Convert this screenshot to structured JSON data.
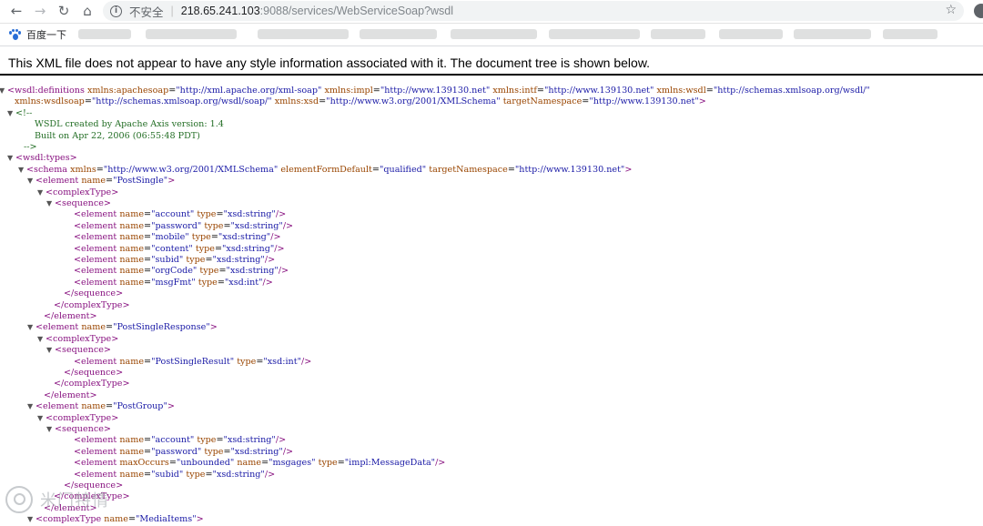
{
  "browser": {
    "url_insecure_label": "不安全",
    "url_host": "218.65.241.103",
    "url_path": ":9088/services/WebServiceSoap?wsdl",
    "bookmark_first": "百度一下"
  },
  "page": {
    "notice": "This XML file does not appear to have any style information associated with it. The document tree is shown below."
  },
  "xml_lines": [
    {
      "indent": 8,
      "tw": "▼",
      "parts": [
        [
          "tag",
          "<wsdl:definitions "
        ],
        [
          "attr",
          "xmlns:apachesoap"
        ],
        [
          "plain",
          "="
        ],
        [
          "val",
          "\"http://xml.apache.org/xml-soap\""
        ],
        [
          "attr",
          " xmlns:impl"
        ],
        [
          "plain",
          "="
        ],
        [
          "val",
          "\"http://www.139130.net\""
        ],
        [
          "attr",
          " xmlns:intf"
        ],
        [
          "plain",
          "="
        ],
        [
          "val",
          "\"http://www.139130.net\""
        ],
        [
          "attr",
          " xmlns:wsdl"
        ],
        [
          "plain",
          "="
        ],
        [
          "val",
          "\"http://schemas.xmlsoap.org/wsdl/\""
        ]
      ]
    },
    {
      "indent": 16,
      "tw": "",
      "parts": [
        [
          "attr",
          "xmlns:wsdlsoap"
        ],
        [
          "plain",
          "="
        ],
        [
          "val",
          "\"http://schemas.xmlsoap.org/wsdl/soap/\""
        ],
        [
          "attr",
          " xmlns:xsd"
        ],
        [
          "plain",
          "="
        ],
        [
          "val",
          "\"http://www.w3.org/2001/XMLSchema\""
        ],
        [
          "attr",
          " targetNamespace"
        ],
        [
          "plain",
          "="
        ],
        [
          "val",
          "\"http://www.139130.net\""
        ],
        [
          "tag",
          ">"
        ]
      ]
    },
    {
      "indent": 17,
      "tw": "▼",
      "parts": [
        [
          "comment",
          "<!--"
        ]
      ]
    },
    {
      "indent": 38,
      "tw": "",
      "parts": [
        [
          "comment",
          "WSDL created by Apache Axis version: 1.4"
        ]
      ]
    },
    {
      "indent": 38,
      "tw": "",
      "parts": [
        [
          "comment",
          "Built on Apr 22, 2006 (06:55:48 PDT)"
        ]
      ]
    },
    {
      "indent": 26,
      "tw": "",
      "parts": [
        [
          "comment",
          "-->"
        ]
      ]
    },
    {
      "indent": 17,
      "tw": "▼",
      "parts": [
        [
          "tag",
          "<wsdl:types>"
        ]
      ]
    },
    {
      "indent": 29,
      "tw": "▼",
      "parts": [
        [
          "tag",
          "<schema "
        ],
        [
          "attr",
          "xmlns"
        ],
        [
          "plain",
          "="
        ],
        [
          "val",
          "\"http://www.w3.org/2001/XMLSchema\""
        ],
        [
          "attr",
          " elementFormDefault"
        ],
        [
          "plain",
          "="
        ],
        [
          "val",
          "\"qualified\""
        ],
        [
          "attr",
          " targetNamespace"
        ],
        [
          "plain",
          "="
        ],
        [
          "val",
          "\"http://www.139130.net\""
        ],
        [
          "tag",
          ">"
        ]
      ]
    },
    {
      "indent": 39,
      "tw": "▼",
      "parts": [
        [
          "tag",
          "<element "
        ],
        [
          "attr",
          "name"
        ],
        [
          "plain",
          "="
        ],
        [
          "val",
          "\"PostSingle\""
        ],
        [
          "tag",
          ">"
        ]
      ]
    },
    {
      "indent": 50,
      "tw": "▼",
      "parts": [
        [
          "tag",
          "<complexType>"
        ]
      ]
    },
    {
      "indent": 60,
      "tw": "▼",
      "parts": [
        [
          "tag",
          "<sequence>"
        ]
      ]
    },
    {
      "indent": 81,
      "tw": "",
      "parts": [
        [
          "tag",
          "<element "
        ],
        [
          "attr",
          "name"
        ],
        [
          "plain",
          "="
        ],
        [
          "val",
          "\"account\""
        ],
        [
          "attr",
          " type"
        ],
        [
          "plain",
          "="
        ],
        [
          "val",
          "\"xsd:string\""
        ],
        [
          "tag",
          "/>"
        ]
      ]
    },
    {
      "indent": 81,
      "tw": "",
      "parts": [
        [
          "tag",
          "<element "
        ],
        [
          "attr",
          "name"
        ],
        [
          "plain",
          "="
        ],
        [
          "val",
          "\"password\""
        ],
        [
          "attr",
          " type"
        ],
        [
          "plain",
          "="
        ],
        [
          "val",
          "\"xsd:string\""
        ],
        [
          "tag",
          "/>"
        ]
      ]
    },
    {
      "indent": 81,
      "tw": "",
      "parts": [
        [
          "tag",
          "<element "
        ],
        [
          "attr",
          "name"
        ],
        [
          "plain",
          "="
        ],
        [
          "val",
          "\"mobile\""
        ],
        [
          "attr",
          " type"
        ],
        [
          "plain",
          "="
        ],
        [
          "val",
          "\"xsd:string\""
        ],
        [
          "tag",
          "/>"
        ]
      ]
    },
    {
      "indent": 81,
      "tw": "",
      "parts": [
        [
          "tag",
          "<element "
        ],
        [
          "attr",
          "name"
        ],
        [
          "plain",
          "="
        ],
        [
          "val",
          "\"content\""
        ],
        [
          "attr",
          " type"
        ],
        [
          "plain",
          "="
        ],
        [
          "val",
          "\"xsd:string\""
        ],
        [
          "tag",
          "/>"
        ]
      ]
    },
    {
      "indent": 81,
      "tw": "",
      "parts": [
        [
          "tag",
          "<element "
        ],
        [
          "attr",
          "name"
        ],
        [
          "plain",
          "="
        ],
        [
          "val",
          "\"subid\""
        ],
        [
          "attr",
          " type"
        ],
        [
          "plain",
          "="
        ],
        [
          "val",
          "\"xsd:string\""
        ],
        [
          "tag",
          "/>"
        ]
      ]
    },
    {
      "indent": 81,
      "tw": "",
      "parts": [
        [
          "tag",
          "<element "
        ],
        [
          "attr",
          "name"
        ],
        [
          "plain",
          "="
        ],
        [
          "val",
          "\"orgCode\""
        ],
        [
          "attr",
          " type"
        ],
        [
          "plain",
          "="
        ],
        [
          "val",
          "\"xsd:string\""
        ],
        [
          "tag",
          "/>"
        ]
      ]
    },
    {
      "indent": 81,
      "tw": "",
      "parts": [
        [
          "tag",
          "<element "
        ],
        [
          "attr",
          "name"
        ],
        [
          "plain",
          "="
        ],
        [
          "val",
          "\"msgFmt\""
        ],
        [
          "attr",
          " type"
        ],
        [
          "plain",
          "="
        ],
        [
          "val",
          "\"xsd:int\""
        ],
        [
          "tag",
          "/>"
        ]
      ]
    },
    {
      "indent": 70,
      "tw": "",
      "parts": [
        [
          "tag",
          "</sequence>"
        ]
      ]
    },
    {
      "indent": 59,
      "tw": "",
      "parts": [
        [
          "tag",
          "</complexType>"
        ]
      ]
    },
    {
      "indent": 48,
      "tw": "",
      "parts": [
        [
          "tag",
          "</element>"
        ]
      ]
    },
    {
      "indent": 39,
      "tw": "▼",
      "parts": [
        [
          "tag",
          "<element "
        ],
        [
          "attr",
          "name"
        ],
        [
          "plain",
          "="
        ],
        [
          "val",
          "\"PostSingleResponse\""
        ],
        [
          "tag",
          ">"
        ]
      ]
    },
    {
      "indent": 50,
      "tw": "▼",
      "parts": [
        [
          "tag",
          "<complexType>"
        ]
      ]
    },
    {
      "indent": 60,
      "tw": "▼",
      "parts": [
        [
          "tag",
          "<sequence>"
        ]
      ]
    },
    {
      "indent": 81,
      "tw": "",
      "parts": [
        [
          "tag",
          "<element "
        ],
        [
          "attr",
          "name"
        ],
        [
          "plain",
          "="
        ],
        [
          "val",
          "\"PostSingleResult\""
        ],
        [
          "attr",
          " type"
        ],
        [
          "plain",
          "="
        ],
        [
          "val",
          "\"xsd:int\""
        ],
        [
          "tag",
          "/>"
        ]
      ]
    },
    {
      "indent": 70,
      "tw": "",
      "parts": [
        [
          "tag",
          "</sequence>"
        ]
      ]
    },
    {
      "indent": 59,
      "tw": "",
      "parts": [
        [
          "tag",
          "</complexType>"
        ]
      ]
    },
    {
      "indent": 48,
      "tw": "",
      "parts": [
        [
          "tag",
          "</element>"
        ]
      ]
    },
    {
      "indent": 39,
      "tw": "▼",
      "parts": [
        [
          "tag",
          "<element "
        ],
        [
          "attr",
          "name"
        ],
        [
          "plain",
          "="
        ],
        [
          "val",
          "\"PostGroup\""
        ],
        [
          "tag",
          ">"
        ]
      ]
    },
    {
      "indent": 50,
      "tw": "▼",
      "parts": [
        [
          "tag",
          "<complexType>"
        ]
      ]
    },
    {
      "indent": 60,
      "tw": "▼",
      "parts": [
        [
          "tag",
          "<sequence>"
        ]
      ]
    },
    {
      "indent": 81,
      "tw": "",
      "parts": [
        [
          "tag",
          "<element "
        ],
        [
          "attr",
          "name"
        ],
        [
          "plain",
          "="
        ],
        [
          "val",
          "\"account\""
        ],
        [
          "attr",
          " type"
        ],
        [
          "plain",
          "="
        ],
        [
          "val",
          "\"xsd:string\""
        ],
        [
          "tag",
          "/>"
        ]
      ]
    },
    {
      "indent": 81,
      "tw": "",
      "parts": [
        [
          "tag",
          "<element "
        ],
        [
          "attr",
          "name"
        ],
        [
          "plain",
          "="
        ],
        [
          "val",
          "\"password\""
        ],
        [
          "attr",
          " type"
        ],
        [
          "plain",
          "="
        ],
        [
          "val",
          "\"xsd:string\""
        ],
        [
          "tag",
          "/>"
        ]
      ]
    },
    {
      "indent": 81,
      "tw": "",
      "parts": [
        [
          "tag",
          "<element "
        ],
        [
          "attr",
          "maxOccurs"
        ],
        [
          "plain",
          "="
        ],
        [
          "val",
          "\"unbounded\""
        ],
        [
          "attr",
          " name"
        ],
        [
          "plain",
          "="
        ],
        [
          "val",
          "\"msgages\""
        ],
        [
          "attr",
          " type"
        ],
        [
          "plain",
          "="
        ],
        [
          "val",
          "\"impl:MessageData\""
        ],
        [
          "tag",
          "/>"
        ]
      ]
    },
    {
      "indent": 81,
      "tw": "",
      "parts": [
        [
          "tag",
          "<element "
        ],
        [
          "attr",
          "name"
        ],
        [
          "plain",
          "="
        ],
        [
          "val",
          "\"subid\""
        ],
        [
          "attr",
          " type"
        ],
        [
          "plain",
          "="
        ],
        [
          "val",
          "\"xsd:string\""
        ],
        [
          "tag",
          "/>"
        ]
      ]
    },
    {
      "indent": 70,
      "tw": "",
      "parts": [
        [
          "tag",
          "</sequence>"
        ]
      ]
    },
    {
      "indent": 59,
      "tw": "",
      "parts": [
        [
          "tag",
          "</complexType>"
        ]
      ]
    },
    {
      "indent": 48,
      "tw": "",
      "parts": [
        [
          "tag",
          "</element>"
        ]
      ]
    },
    {
      "indent": 39,
      "tw": "▼",
      "parts": [
        [
          "tag",
          "<complexType "
        ],
        [
          "attr",
          "name"
        ],
        [
          "plain",
          "="
        ],
        [
          "val",
          "\"MediaItems\""
        ],
        [
          "tag",
          ">"
        ]
      ]
    }
  ],
  "watermark": {
    "text": "米门特情"
  },
  "icons": {
    "back": "back-arrow-icon",
    "forward": "forward-arrow-icon",
    "reload": "reload-icon",
    "home": "home-icon",
    "info": "info-icon",
    "star": "star-icon",
    "profile": "profile-icon",
    "paw": "baidu-paw-icon"
  },
  "colors": {
    "tag": "#881280",
    "attr": "#994500",
    "value": "#1a1aa6",
    "comment": "#236e25"
  }
}
